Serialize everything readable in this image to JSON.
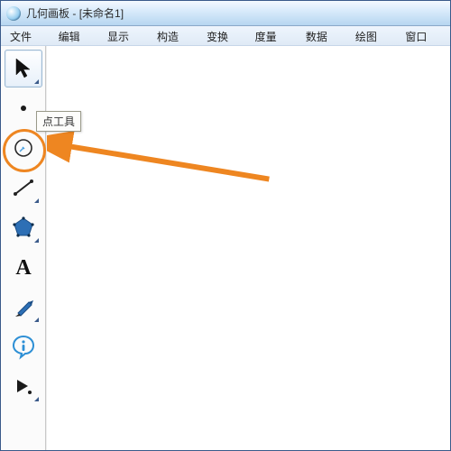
{
  "window": {
    "app_name": "几何画板",
    "doc_name": "[未命名1]",
    "title_sep": " - "
  },
  "menu": {
    "file": "文件(F)",
    "edit": "编辑(E)",
    "display": "显示(D)",
    "construct": "构造(C)",
    "transform": "变换(T)",
    "measure": "度量(M)",
    "data": "数据(N)",
    "graph": "绘图(G)",
    "window": "窗口(G)"
  },
  "tooltip": {
    "point_tool": "点工具"
  },
  "colors": {
    "accent": "#ee8621",
    "blue": "#2d6fb5"
  }
}
